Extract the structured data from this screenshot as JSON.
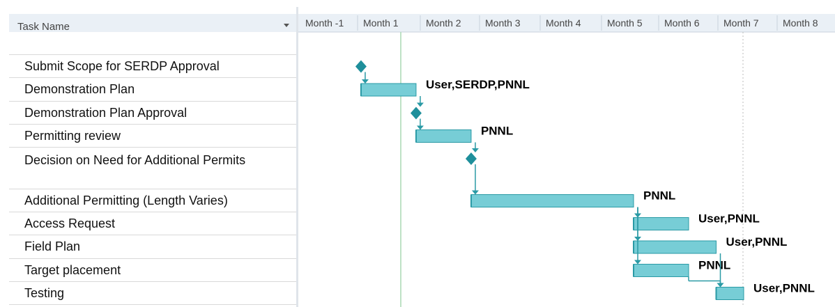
{
  "task_header": {
    "label": "Task Name",
    "dropdown_icon": "chevron-down-icon"
  },
  "chart_data": {
    "type": "gantt",
    "time_axis": [
      "Month -1",
      "Month 1",
      "Month 2",
      "Month 3",
      "Month 4",
      "Month 5",
      "Month 6",
      "Month 7",
      "Month 8"
    ],
    "tasks": [
      {
        "name": "",
        "milestone": false,
        "start": null,
        "end": null,
        "resources": ""
      },
      {
        "name": "Submit Scope for SERDP Approval",
        "milestone": true,
        "start": 0.05,
        "end": 0.05,
        "resources": ""
      },
      {
        "name": "Demonstration Plan",
        "milestone": false,
        "start": 0.05,
        "end": 1.05,
        "resources": "User,SERDP,PNNL"
      },
      {
        "name": " Demonstration Plan Approval",
        "milestone": true,
        "start": 1.05,
        "end": 1.05,
        "resources": ""
      },
      {
        "name": "Permitting review",
        "milestone": false,
        "start": 1.05,
        "end": 2.05,
        "resources": "PNNL"
      },
      {
        "name": "Decision on Need for Additional Permits",
        "milestone": true,
        "start": 2.05,
        "end": 2.05,
        "resources": ""
      },
      {
        "name": "Additional Permitting (Length Varies)",
        "milestone": false,
        "start": 2.05,
        "end": 5.0,
        "resources": "PNNL"
      },
      {
        "name": "Access Request",
        "milestone": false,
        "start": 5.0,
        "end": 6.0,
        "resources": "User,PNNL"
      },
      {
        "name": "Field Plan",
        "milestone": false,
        "start": 5.0,
        "end": 6.5,
        "resources": "User,PNNL"
      },
      {
        "name": "Target placement",
        "milestone": false,
        "start": 5.0,
        "end": 6.0,
        "resources": "PNNL"
      },
      {
        "name": "Testing",
        "milestone": false,
        "start": 6.5,
        "end": 7.0,
        "resources": "User,PNNL"
      }
    ],
    "colors": {
      "bar": "#77cdd6",
      "bar_edge": "#2a9aa5",
      "milestone": "#1e8f9b",
      "arrow": "#2a9aa5",
      "grid": "#e3e3e3",
      "today": "#a9d9b3"
    }
  }
}
